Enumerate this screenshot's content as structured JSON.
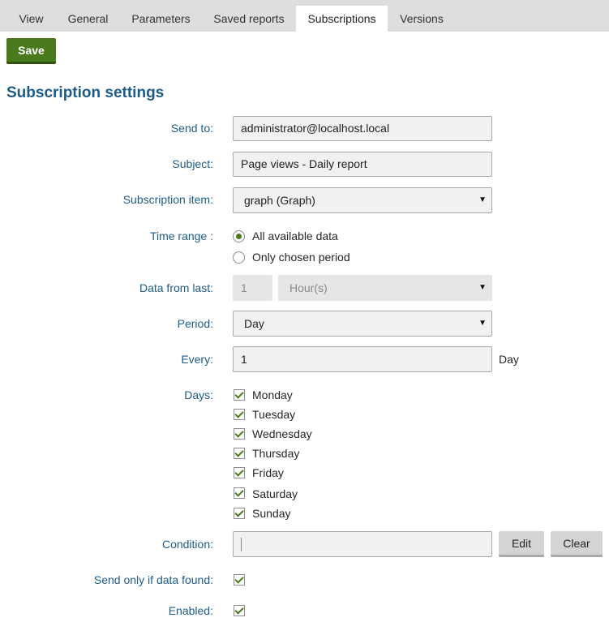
{
  "tabs": [
    {
      "label": "View"
    },
    {
      "label": "General"
    },
    {
      "label": "Parameters"
    },
    {
      "label": "Saved reports"
    },
    {
      "label": "Subscriptions",
      "active": true
    },
    {
      "label": "Versions"
    }
  ],
  "toolbar": {
    "save_label": "Save"
  },
  "section_title": "Subscription settings",
  "form": {
    "send_to": {
      "label": "Send to:",
      "value": "administrator@localhost.local"
    },
    "subject": {
      "label": "Subject:",
      "value": "Page views - Daily report"
    },
    "subscription_item": {
      "label": "Subscription item:",
      "value": "graph (Graph)"
    },
    "time_range": {
      "label": "Time range :",
      "options": [
        "All available data",
        "Only chosen period"
      ],
      "selected": "All available data"
    },
    "data_from_last": {
      "label": "Data from last:",
      "number": "1",
      "unit": "Hour(s)"
    },
    "period": {
      "label": "Period:",
      "value": "Day"
    },
    "every": {
      "label": "Every:",
      "value": "1",
      "unit": "Day"
    },
    "days": {
      "label": "Days:",
      "items": [
        {
          "name": "Monday",
          "checked": true
        },
        {
          "name": "Tuesday",
          "checked": true
        },
        {
          "name": "Wednesday",
          "checked": true
        },
        {
          "name": "Thursday",
          "checked": true
        },
        {
          "name": "Friday",
          "checked": true
        },
        {
          "name": "Saturday",
          "checked": true
        },
        {
          "name": "Sunday",
          "checked": true
        }
      ]
    },
    "condition": {
      "label": "Condition:",
      "value": "",
      "edit_label": "Edit",
      "clear_label": "Clear"
    },
    "send_only_if_data": {
      "label": "Send only if data found:",
      "checked": true
    },
    "enabled": {
      "label": "Enabled:",
      "checked": true
    }
  },
  "colors": {
    "accent": "#4a7a1c",
    "label": "#1e5c88",
    "tab_bar": "#dedede"
  },
  "icons": {
    "dropdown": "chevron-down-icon",
    "check": "check-icon"
  }
}
